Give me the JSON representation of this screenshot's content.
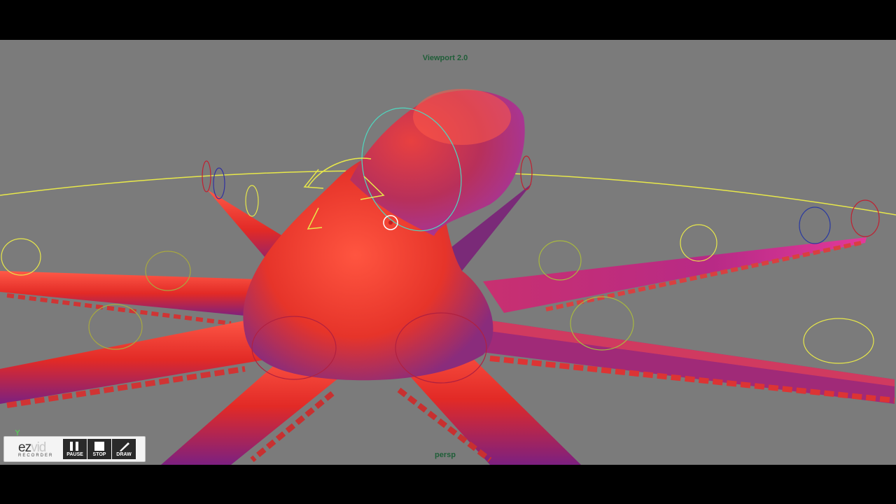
{
  "viewport": {
    "title": "Viewport 2.0",
    "camera": "persp",
    "background": "#7b7b7b"
  },
  "scene": {
    "subject": "octopus",
    "body_color": "#e8342c",
    "shadow_color": "#8a2c8c",
    "control_curve_color": "#f0f050"
  },
  "recorder": {
    "logo_ez": "ez",
    "logo_vid": "vid",
    "logo_sub": "RECORDER",
    "buttons": [
      {
        "label": "PAUSE",
        "icon": "pause-icon"
      },
      {
        "label": "STOP",
        "icon": "stop-icon"
      },
      {
        "label": "DRAW",
        "icon": "pen-icon"
      }
    ]
  }
}
